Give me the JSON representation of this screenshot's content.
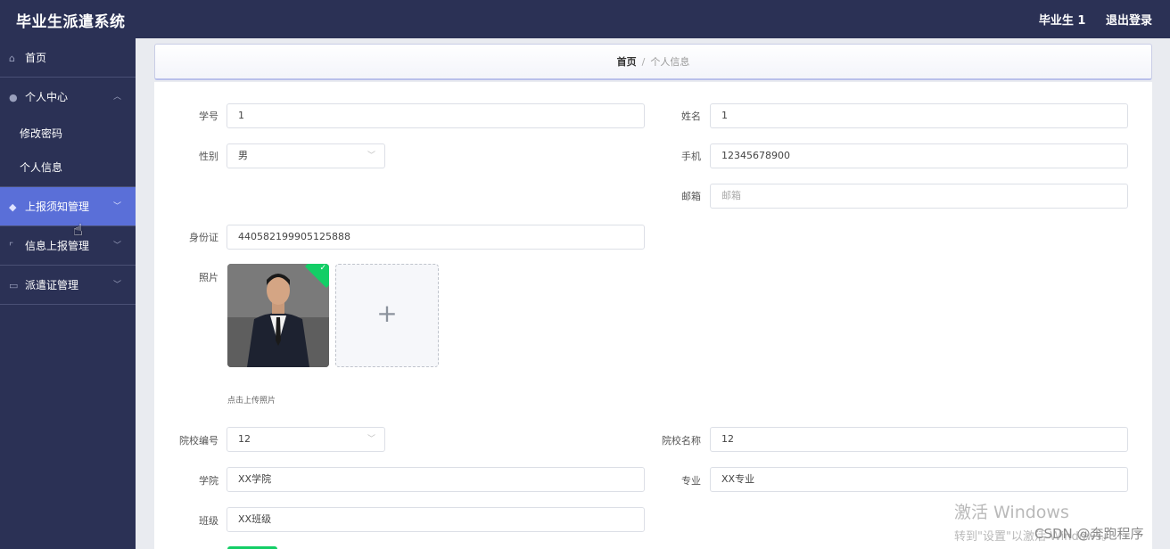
{
  "header": {
    "title": "毕业生派遣系统",
    "user": "毕业生 1",
    "logout": "退出登录"
  },
  "sidebar": {
    "home": "首页",
    "personal_center": "个人中心",
    "change_password": "修改密码",
    "personal_info": "个人信息",
    "report_notice": "上报须知管理",
    "info_report": "信息上报管理",
    "dispatch_cert": "派遣证管理"
  },
  "breadcrumb": {
    "home": "首页",
    "separator": "/",
    "current": "个人信息"
  },
  "form": {
    "student_no": {
      "label": "学号",
      "value": "1"
    },
    "name": {
      "label": "姓名",
      "value": "1"
    },
    "gender": {
      "label": "性别",
      "value": "男"
    },
    "phone": {
      "label": "手机",
      "value": "12345678900"
    },
    "email": {
      "label": "邮箱",
      "placeholder": "邮箱"
    },
    "id_card": {
      "label": "身份证",
      "value": "440582199905125888"
    },
    "photo": {
      "label": "照片",
      "hint": "点击上传照片",
      "add": "+"
    },
    "school_code": {
      "label": "院校编号",
      "value": "12"
    },
    "school_name": {
      "label": "院校名称",
      "value": "12"
    },
    "college": {
      "label": "学院",
      "value": "XX学院"
    },
    "major": {
      "label": "专业",
      "value": "XX专业"
    },
    "class": {
      "label": "班级",
      "value": "XX班级"
    }
  },
  "overlay": {
    "win_title": "激活 Windows",
    "win_sub": "转到\"设置\"以激活 Windows。",
    "csdn": "CSDN @奔跑程序"
  },
  "colors": {
    "header_bg": "#2b3155",
    "active_menu": "#5a6fd8",
    "success": "#13ce66"
  }
}
